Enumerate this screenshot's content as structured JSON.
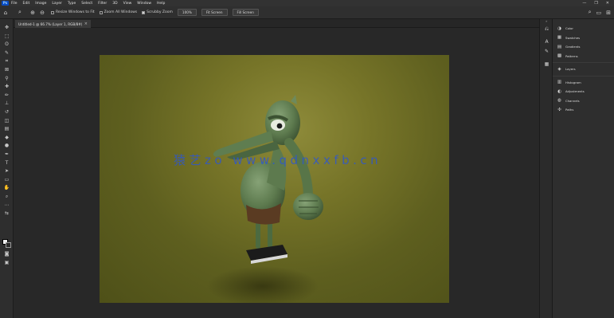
{
  "menubar": {
    "logo": "Ps",
    "items": [
      "File",
      "Edit",
      "Image",
      "Layer",
      "Type",
      "Select",
      "Filter",
      "3D",
      "View",
      "Window",
      "Help"
    ],
    "window_controls": [
      "—",
      "❐",
      "✕"
    ]
  },
  "options": {
    "tool_icon": "zoom-icon",
    "zoom_in_glyph": "⊕",
    "zoom_out_glyph": "⊖",
    "resize_windows_label": "Resize Windows to Fit",
    "zoom_all_label": "Zoom All Windows",
    "scrubby_label": "Scrubby Zoom",
    "scrubby_checked": true,
    "btn_100": "100%",
    "btn_fit": "Fit Screen",
    "btn_fill": "Fill Screen",
    "right_icons": [
      "⌕",
      "▭",
      "⊞"
    ]
  },
  "toolbar": {
    "tools": [
      {
        "name": "move-tool-icon",
        "glyph": "✥"
      },
      {
        "name": "marquee-tool-icon",
        "glyph": "⬚"
      },
      {
        "name": "lasso-tool-icon",
        "glyph": "ʘ"
      },
      {
        "name": "quick-select-tool-icon",
        "glyph": "✎"
      },
      {
        "name": "crop-tool-icon",
        "glyph": "⌗"
      },
      {
        "name": "frame-tool-icon",
        "glyph": "⊠"
      },
      {
        "name": "eyedropper-tool-icon",
        "glyph": "⚲"
      },
      {
        "name": "healing-tool-icon",
        "glyph": "✚"
      },
      {
        "name": "brush-tool-icon",
        "glyph": "✏"
      },
      {
        "name": "stamp-tool-icon",
        "glyph": "⊥"
      },
      {
        "name": "history-brush-tool-icon",
        "glyph": "↺"
      },
      {
        "name": "eraser-tool-icon",
        "glyph": "◫"
      },
      {
        "name": "gradient-tool-icon",
        "glyph": "▤"
      },
      {
        "name": "blur-tool-icon",
        "glyph": "◆"
      },
      {
        "name": "dodge-tool-icon",
        "glyph": "●"
      },
      {
        "name": "pen-tool-icon",
        "glyph": "✒"
      },
      {
        "name": "type-tool-icon",
        "glyph": "T"
      },
      {
        "name": "path-select-tool-icon",
        "glyph": "➤"
      },
      {
        "name": "shape-tool-icon",
        "glyph": "▭"
      },
      {
        "name": "hand-tool-icon",
        "glyph": "✋"
      },
      {
        "name": "zoom-tool-icon",
        "glyph": "⌕"
      },
      {
        "name": "more-tools-icon",
        "glyph": "⋯"
      },
      {
        "name": "swap-colors-icon",
        "glyph": "⇆"
      }
    ],
    "bottom_tools": [
      {
        "name": "quick-mask-icon",
        "glyph": "◙"
      },
      {
        "name": "screen-mode-icon",
        "glyph": "▣"
      }
    ]
  },
  "document": {
    "tab_title": "Untitled-1 @ 66.7% (Layer 1, RGB/8#)",
    "close_glyph": "×",
    "watermark": "猿艺zo  www.qdnxxfb.cn"
  },
  "panel_strip": {
    "icons": [
      {
        "name": "history-icon",
        "glyph": "⎌"
      },
      {
        "name": "character-icon",
        "glyph": "A"
      },
      {
        "name": "brush-settings-icon",
        "glyph": "✎"
      },
      {
        "name": "properties-icon",
        "glyph": "▦"
      }
    ],
    "collapse_glyph": "»"
  },
  "panels": {
    "groups": [
      [
        {
          "icon": "color-icon",
          "glyph": "◑",
          "label": "Color"
        },
        {
          "icon": "swatches-icon",
          "glyph": "▦",
          "label": "Swatches"
        },
        {
          "icon": "gradients-icon",
          "glyph": "▤",
          "label": "Gradients"
        },
        {
          "icon": "patterns-icon",
          "glyph": "▩",
          "label": "Patterns"
        }
      ],
      [
        {
          "icon": "layers-icon",
          "glyph": "◈",
          "label": "Layers"
        }
      ],
      [
        {
          "icon": "histogram-icon",
          "glyph": "▥",
          "label": "Histogram"
        },
        {
          "icon": "adjustments-icon",
          "glyph": "◐",
          "label": "Adjustments"
        },
        {
          "icon": "channels-icon",
          "glyph": "◍",
          "label": "Channels"
        },
        {
          "icon": "paths-icon",
          "glyph": "✣",
          "label": "Paths"
        }
      ]
    ]
  }
}
